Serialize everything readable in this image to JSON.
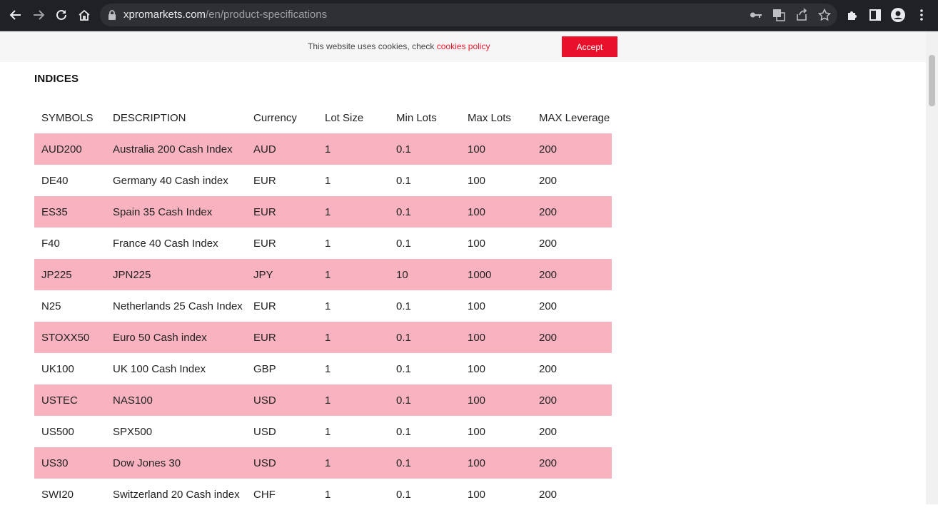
{
  "browser": {
    "url_host": "xpromarkets.com",
    "url_path": "/en/product-specifications",
    "icons": [
      "back-icon",
      "forward-icon",
      "reload-icon",
      "home-icon",
      "lock-icon",
      "key-icon",
      "translate-icon",
      "share-icon",
      "star-icon",
      "extensions-icon",
      "side-panel-icon",
      "profile-icon",
      "menu-icon"
    ]
  },
  "cookie": {
    "text": "This website uses cookies, check ",
    "link": "cookies policy",
    "accept": "Accept",
    "accent_color": "#e8102a"
  },
  "section": {
    "title": "INDICES"
  },
  "table": {
    "headers": [
      "SYMBOLS",
      "DESCRIPTION",
      "Currency",
      "Lot Size",
      "Min Lots",
      "Max Lots",
      "MAX Leverage"
    ],
    "row_highlight_color": "#f9b3c0",
    "rows": [
      [
        "AUD200",
        "Australia 200 Cash Index",
        "AUD",
        "1",
        "0.1",
        "100",
        "200"
      ],
      [
        "DE40",
        "Germany 40 Cash index",
        "EUR",
        "1",
        "0.1",
        "100",
        "200"
      ],
      [
        "ES35",
        "Spain 35 Cash Index",
        "EUR",
        "1",
        "0.1",
        "100",
        "200"
      ],
      [
        "F40",
        "France 40 Cash Index",
        "EUR",
        "1",
        "0.1",
        "100",
        "200"
      ],
      [
        "JP225",
        "JPN225",
        "JPY",
        "1",
        "10",
        "1000",
        "200"
      ],
      [
        "N25",
        "Netherlands 25 Cash Index",
        "EUR",
        "1",
        "0.1",
        "100",
        "200"
      ],
      [
        "STOXX50",
        "Euro 50 Cash index",
        "EUR",
        "1",
        "0.1",
        "100",
        "200"
      ],
      [
        "UK100",
        "UK 100 Cash Index",
        "GBP",
        "1",
        "0.1",
        "100",
        "200"
      ],
      [
        "USTEC",
        "NAS100",
        "USD",
        "1",
        "0.1",
        "100",
        "200"
      ],
      [
        "US500",
        "SPX500",
        "USD",
        "1",
        "0.1",
        "100",
        "200"
      ],
      [
        "US30",
        "Dow Jones 30",
        "USD",
        "1",
        "0.1",
        "100",
        "200"
      ],
      [
        "SWI20",
        "Switzerland 20 Cash index",
        "CHF",
        "1",
        "0.1",
        "100",
        "200"
      ]
    ]
  }
}
